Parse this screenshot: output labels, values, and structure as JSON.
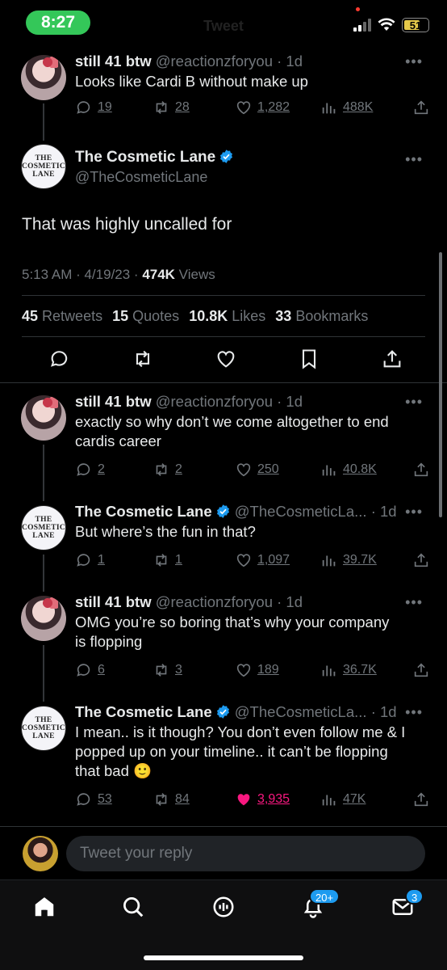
{
  "status_bar": {
    "time": "8:27",
    "battery": "51",
    "ghost_title": "Tweet"
  },
  "tweets_top": [
    {
      "name": "still 41 btw",
      "handle": "@reactionzforyou",
      "age": "· 1d",
      "text": "Looks like Cardi B without make up",
      "replies": "19",
      "retweets": "28",
      "likes": "1,282",
      "views": "488K"
    }
  ],
  "main_tweet": {
    "name": "The Cosmetic Lane",
    "handle": "@TheCosmeticLane",
    "avatar_text": [
      "THE",
      "COSMETIC",
      "LANE"
    ],
    "text": "That was highly uncalled for",
    "meta_time": "5:13 AM · 4/19/23 · ",
    "meta_views_num": "474K",
    "meta_views_label": " Views",
    "stats": {
      "retweets_num": "45",
      "retweets_label": "Retweets",
      "quotes_num": "15",
      "quotes_label": "Quotes",
      "likes_num": "10.8K",
      "likes_label": "Likes",
      "bookmarks_num": "33",
      "bookmarks_label": "Bookmarks"
    }
  },
  "replies": [
    {
      "name": "still 41 btw",
      "handle": "@reactionzforyou",
      "age": "· 1d",
      "text_lines": [
        "exactly so why don’t we come altogether to end",
        "cardis career"
      ],
      "replies": "2",
      "retweets": "2",
      "likes": "250",
      "views": "40.8K"
    },
    {
      "name": "The Cosmetic Lane",
      "handle": "@TheCosmeticLa...",
      "age": "· 1d",
      "text_lines": [
        "But where’s the fun in that?"
      ],
      "replies": "1",
      "retweets": "1",
      "likes": "1,097",
      "views": "39.7K"
    },
    {
      "name": "still 41 btw",
      "handle": "@reactionzforyou",
      "age": "· 1d",
      "text_lines": [
        "OMG you’re so boring that’s why your company",
        "is flopping"
      ],
      "replies": "6",
      "retweets": "3",
      "likes": "189",
      "views": "36.7K"
    },
    {
      "name": "The Cosmetic Lane",
      "handle": "@TheCosmeticLa...",
      "age": "· 1d",
      "text_lines": [
        "I mean.. is it though? You don’t even follow me & I",
        "popped up on your timeline.. it can’t be flopping",
        "that bad 🙂"
      ],
      "replies": "53",
      "retweets": "84",
      "likes": "3,935",
      "views": "47K"
    }
  ],
  "more_glyph": "•••",
  "reply_bar": {
    "placeholder": "Tweet your reply"
  },
  "tab_bar": {
    "notifications_badge": "20+",
    "messages_badge": "3"
  },
  "colors": {
    "accent": "#1d9bf0",
    "liked": "#f91880",
    "muted": "#71767b",
    "time_pill": "#34c759"
  }
}
